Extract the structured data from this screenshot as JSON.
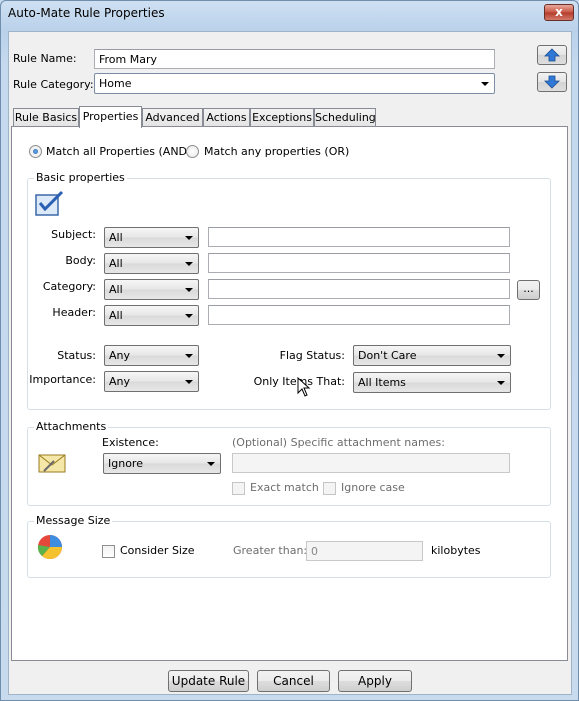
{
  "window": {
    "title": "Auto-Mate Rule Properties",
    "close_glyph": "x"
  },
  "rule": {
    "name_label": "Rule Name:",
    "name_value": "From Mary",
    "category_label": "Rule Category:",
    "category_value": "Home"
  },
  "tabs": [
    "Rule Basics",
    "Properties",
    "Advanced",
    "Actions",
    "Exceptions",
    "Scheduling"
  ],
  "match": {
    "all_label": "Match all Properties (AND)",
    "any_label": "Match any properties (OR)",
    "selected": "all"
  },
  "basic": {
    "title": "Basic properties",
    "subject_label": "Subject:",
    "subject_mode": "All",
    "subject_value": "",
    "body_label": "Body:",
    "body_mode": "All",
    "body_value": "",
    "category_label": "Category:",
    "category_mode": "All",
    "category_value": "",
    "browse_label": "...",
    "header_label": "Header:",
    "header_mode": "All",
    "header_value": "",
    "status_label": "Status:",
    "status_value": "Any",
    "importance_label": "Importance:",
    "importance_value": "Any",
    "flag_label": "Flag Status:",
    "flag_value": "Don't Care",
    "only_label": "Only Items That:",
    "only_value": "All Items"
  },
  "attachments": {
    "title": "Attachments",
    "existence_label": "Existence:",
    "existence_value": "Ignore",
    "names_label": "(Optional) Specific attachment names:",
    "names_value": "",
    "exact_label": "Exact match",
    "ignore_case_label": "Ignore case"
  },
  "size": {
    "title": "Message Size",
    "consider_label": "Consider Size",
    "greater_label": "Greater than:",
    "greater_value": "0",
    "unit_label": "kilobytes"
  },
  "footer": {
    "update_label": "Update Rule",
    "cancel_label": "Cancel",
    "apply_label": "Apply"
  }
}
